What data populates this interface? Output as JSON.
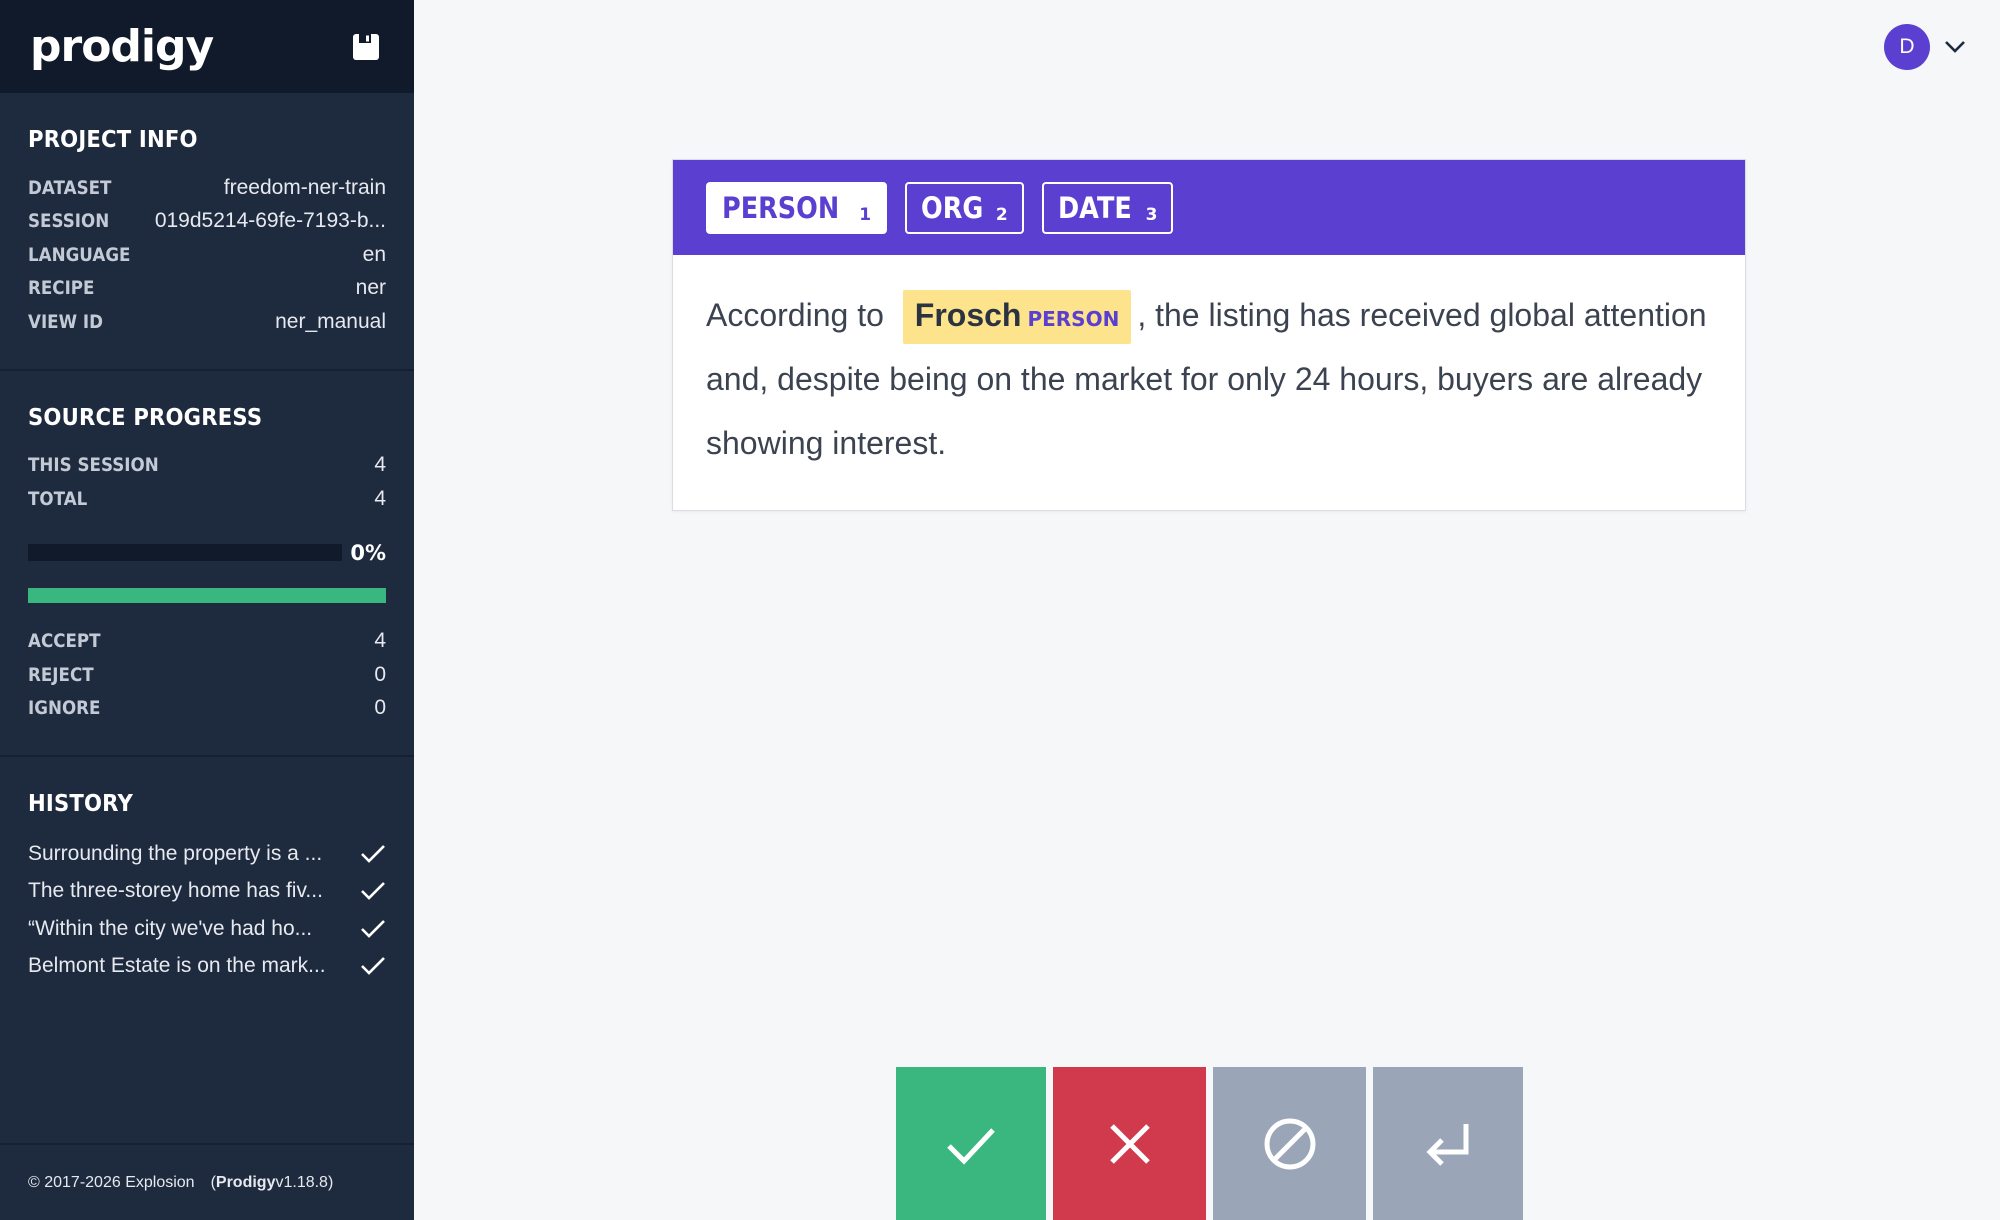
{
  "app": {
    "logo": "prodigy"
  },
  "project_info": {
    "title": "PROJECT INFO",
    "rows": [
      {
        "key": "DATASET",
        "value": "freedom-ner-train"
      },
      {
        "key": "SESSION",
        "value": "019d5214-69fe-7193-b..."
      },
      {
        "key": "LANGUAGE",
        "value": "en"
      },
      {
        "key": "RECIPE",
        "value": "ner"
      },
      {
        "key": "VIEW ID",
        "value": "ner_manual"
      }
    ]
  },
  "source_progress": {
    "title": "SOURCE PROGRESS",
    "this_session_label": "THIS SESSION",
    "this_session": "4",
    "total_label": "TOTAL",
    "total": "4",
    "progress_pct_text": "0%",
    "progress_fraction": 0,
    "accept_label": "ACCEPT",
    "accept": "4",
    "reject_label": "REJECT",
    "reject": "0",
    "ignore_label": "IGNORE",
    "ignore": "0"
  },
  "history": {
    "title": "HISTORY",
    "items": [
      {
        "text": "Surrounding the property is a ...",
        "icon": "check-icon"
      },
      {
        "text": "The three-storey home has fiv...",
        "icon": "check-icon"
      },
      {
        "text": "“Within the city we've had ho...",
        "icon": "check-icon"
      },
      {
        "text": "Belmont Estate is on the mark...",
        "icon": "check-icon"
      }
    ]
  },
  "footer": {
    "copyright": "© 2017-2026 Explosion",
    "open_paren": "(",
    "product": "Prodigy",
    "version": " v1.18.8)"
  },
  "user": {
    "initial": "D"
  },
  "labels": [
    {
      "name": "PERSON",
      "key": "1",
      "active": true
    },
    {
      "name": "ORG",
      "key": "2",
      "active": false
    },
    {
      "name": "DATE",
      "key": "3",
      "active": false
    }
  ],
  "task": {
    "before": "According to",
    "entity_text": "Frosch",
    "entity_label": "PERSON",
    "after": ", the listing has received global attention and, despite being on the market for only 24 hours, buyers are already showing interest."
  },
  "colors": {
    "sidebar": "#1e2a3d",
    "label_bar": "#5a3fd1",
    "accept": "#3ab77f",
    "reject": "#d13a4d",
    "ignore": "#9aa5b8",
    "entity_highlight": "#fde38c"
  },
  "actions": [
    {
      "name": "accept",
      "icon": "check-icon"
    },
    {
      "name": "reject",
      "icon": "close-icon"
    },
    {
      "name": "ignore",
      "icon": "ignore-icon"
    },
    {
      "name": "undo",
      "icon": "undo-icon"
    }
  ]
}
